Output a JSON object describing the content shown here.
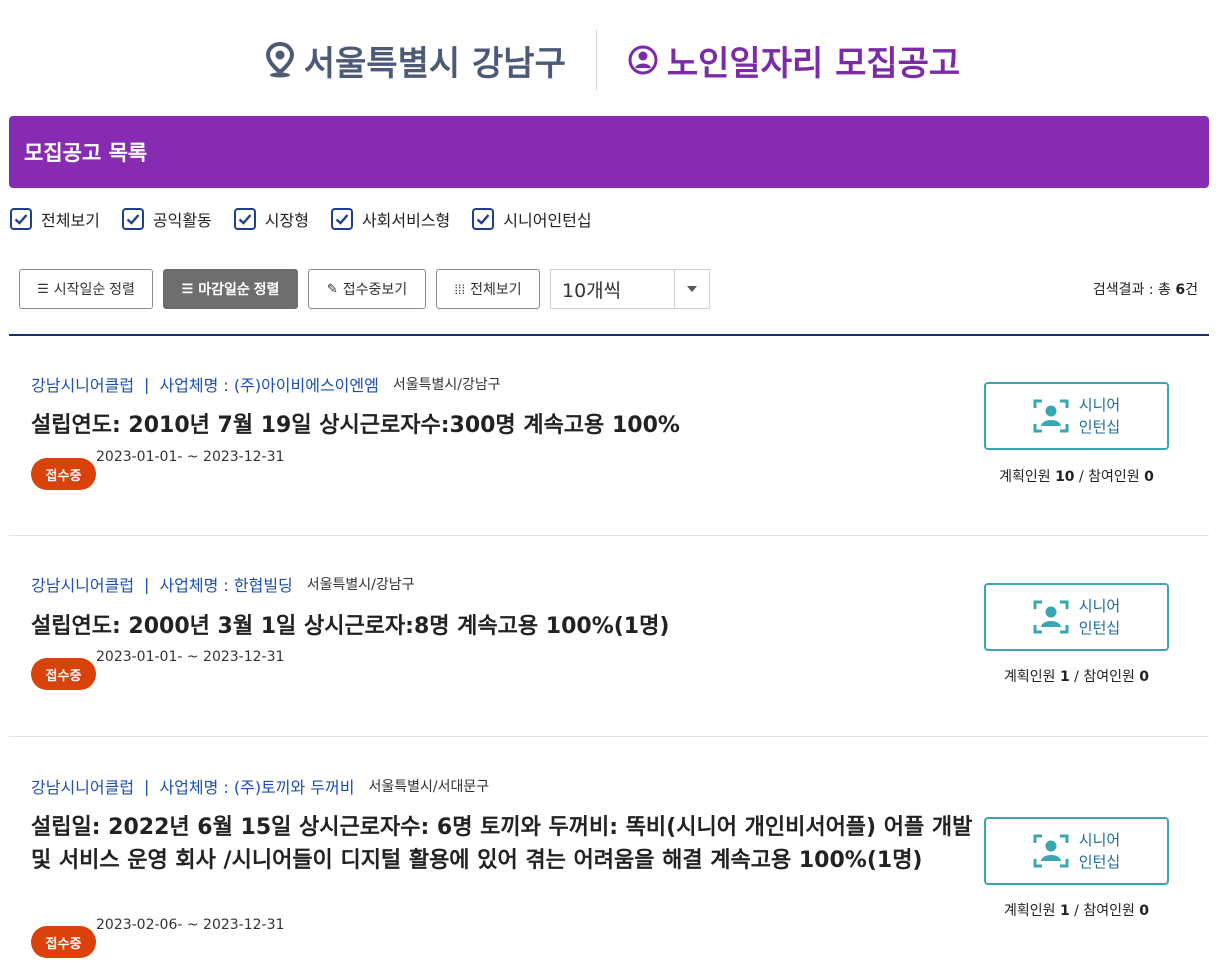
{
  "header": {
    "region": "서울특별시 강남구",
    "title": "노인일자리 모집공고"
  },
  "banner": {
    "title": "모집공고 목록"
  },
  "filters": [
    {
      "label": "전체보기",
      "checked": true
    },
    {
      "label": "공익활동",
      "checked": true
    },
    {
      "label": "시장형",
      "checked": true
    },
    {
      "label": "사회서비스형",
      "checked": true
    },
    {
      "label": "시니어인턴십",
      "checked": true
    }
  ],
  "toolbar": {
    "sort_start": "시작일순 정렬",
    "sort_deadline": "마감일순 정렬",
    "view_receiving": "접수중보기",
    "view_all": "전체보기",
    "per_page": "10개씩"
  },
  "result": {
    "label": "검색결과 : 총",
    "count": "6",
    "unit": "건"
  },
  "items": [
    {
      "org": "강남시니어클럽",
      "separator": "|",
      "business": "사업체명 : (주)아이비에스이엔엠",
      "location": "서울특별시/강남구",
      "title": "설립연도: 2010년 7월 19일 상시근로자수:300명 계속고용 100%",
      "status": "접수중",
      "period": "2023-01-01- ~ 2023-12-31",
      "button_line1": "시니어",
      "button_line2": "인턴십",
      "planned_label": "계획인원",
      "planned": "10",
      "slash": "/",
      "joined_label": "참여인원",
      "joined": "0"
    },
    {
      "org": "강남시니어클럽",
      "separator": "|",
      "business": "사업체명 : 한협빌딩",
      "location": "서울특별시/강남구",
      "title": "설립연도: 2000년 3월 1일 상시근로자:8명 계속고용 100%(1명)",
      "status": "접수중",
      "period": "2023-01-01- ~ 2023-12-31",
      "button_line1": "시니어",
      "button_line2": "인턴십",
      "planned_label": "계획인원",
      "planned": "1",
      "slash": "/",
      "joined_label": "참여인원",
      "joined": "0"
    },
    {
      "org": "강남시니어클럽",
      "separator": "|",
      "business": "사업체명 : (주)토끼와 두꺼비",
      "location": "서울특별시/서대문구",
      "title": "설립일: 2022년 6월 15일 상시근로자수: 6명 토끼와 두꺼비: 똑비(시니어 개인비서어플) 어플 개발 및 서비스 운영 회사 /시니어들이 디지털 활용에 있어 겪는 어려움을 해결 계속고용 100%(1명)",
      "status": "접수중",
      "period": "2023-02-06- ~ 2023-12-31",
      "button_line1": "시니어",
      "button_line2": "인턴십",
      "planned_label": "계획인원",
      "planned": "1",
      "slash": "/",
      "joined_label": "참여인원",
      "joined": "0"
    }
  ],
  "colors": {
    "brand_purple": "#872bb3",
    "header_navy": "#4c5a78",
    "link_blue": "#1c4fb0",
    "badge_orange": "#d9420b",
    "teal": "#3aa6b0"
  },
  "icons": {
    "region": "location-pin-icon",
    "title": "person-circle-icon",
    "filter_check": "checkmark-icon",
    "list": "list-icon",
    "pencil": "pencil-icon",
    "grid": "grid-icon",
    "dropdown": "caret-down-icon",
    "intern": "person-focus-icon"
  }
}
